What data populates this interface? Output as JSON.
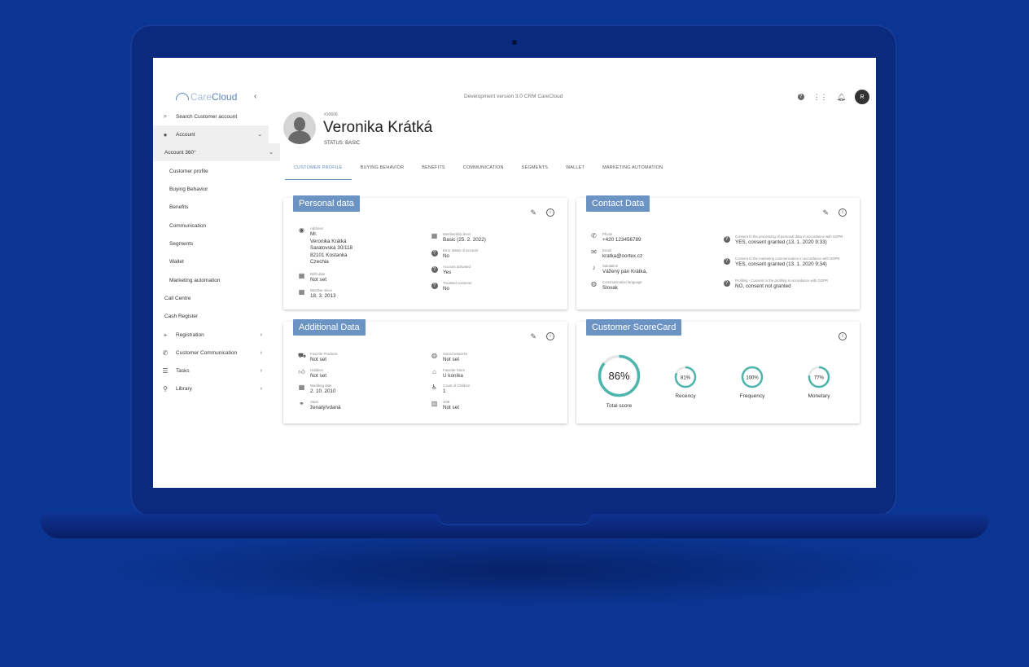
{
  "app": {
    "logo_light": "Care",
    "logo_bold": "Cloud",
    "dev_version": "Development version 3.0 CRM CareCloud",
    "user_initial": "R"
  },
  "sidebar": {
    "search": "Search Customer account",
    "account": "Account",
    "account360": "Account 360°",
    "sub_items": [
      "Customer profile",
      "Buying Behavior",
      "Benefits",
      "Communication",
      "Segments",
      "Wallet",
      "Marketing automation"
    ],
    "call_centre": "Call Centre",
    "cash_register": "Cash Register",
    "registration": "Registration",
    "customer_communication": "Customer Communication",
    "tasks": "Tasks",
    "library": "Library"
  },
  "customer": {
    "id": "#10606",
    "name": "Veronika Krátká",
    "status": "STATUS: BASIC"
  },
  "tabs": [
    "CUSTOMER PROFILE",
    "BUYING BEHAVIOR",
    "BENEFITS",
    "COMMUNICATION",
    "SEGMENTS",
    "WALLET",
    "MARKETING AUTOMATION"
  ],
  "personal": {
    "title": "Personal data",
    "address_label": "Address",
    "address_lines": [
      "Mr.",
      "Veronika Krátká",
      "Saratovská 30/118",
      "82101 Kostanka",
      "Czechia"
    ],
    "birth_label": "Birth date",
    "birth_value": "Not set",
    "member_label": "Member since",
    "member_value": "18. 3. 2013",
    "level_label": "Membership level",
    "level_value": "Basic (25. 2. 2022)",
    "error_label": "Error status of account",
    "error_value": "No",
    "activated_label": "Account activated",
    "activated_value": "Yes",
    "troubled_label": "Troubled customer",
    "troubled_value": "No"
  },
  "contact": {
    "title": "Contact Data",
    "phone_label": "Phone",
    "phone_value": "+420 123456789",
    "email_label": "Email",
    "email_value": "kratka@oortex.cz",
    "salutation_label": "Salutation",
    "salutation_value": "Vážený pán Krátká,",
    "lang_label": "Communication language",
    "lang_value": "Slovak",
    "gdpr1_label": "Consent to the processing of personal data in accordance with GDPR",
    "gdpr1_value": "YES, consent granted (13. 1. 2020 9:33)",
    "gdpr2_label": "Consent to the marketing communication in accordance with GDPR",
    "gdpr2_value": "YES, consent granted (13. 1. 2020 9:34)",
    "gdpr3_label": "Profiling - Consent to the profiling in accordance with GDPR",
    "gdpr3_value": "NO, consent not granted"
  },
  "additional": {
    "title": "Additional Data",
    "fav_products_label": "Favorite Products",
    "fav_products_value": "Not set",
    "hobbies_label": "Hobbies",
    "hobbies_value": "Not set",
    "wedding_label": "Wedding date",
    "wedding_value": "2. 10. 2010",
    "state_label": "State",
    "state_value": "ženatý/vdaná",
    "social_label": "Social networks",
    "social_value": "Not set",
    "store_label": "Favorite Store",
    "store_value": "U koníka",
    "children_label": "Count of Children",
    "children_value": "1",
    "job_label": "JOB",
    "job_value": "Not set"
  },
  "scorecard": {
    "title": "Customer ScoreCard",
    "total": {
      "label": "Total score",
      "text": "86%",
      "fraction": 0.86
    },
    "recency": {
      "label": "Recency",
      "text": "81%",
      "fraction": 0.81
    },
    "frequency": {
      "label": "Frequency",
      "text": "100%",
      "fraction": 1.0
    },
    "monetary": {
      "label": "Monetary",
      "text": "77%",
      "fraction": 0.77
    }
  },
  "colors": {
    "accent": "#6b93c4",
    "gauge": "#4db6ac",
    "background": "#0b3592"
  }
}
